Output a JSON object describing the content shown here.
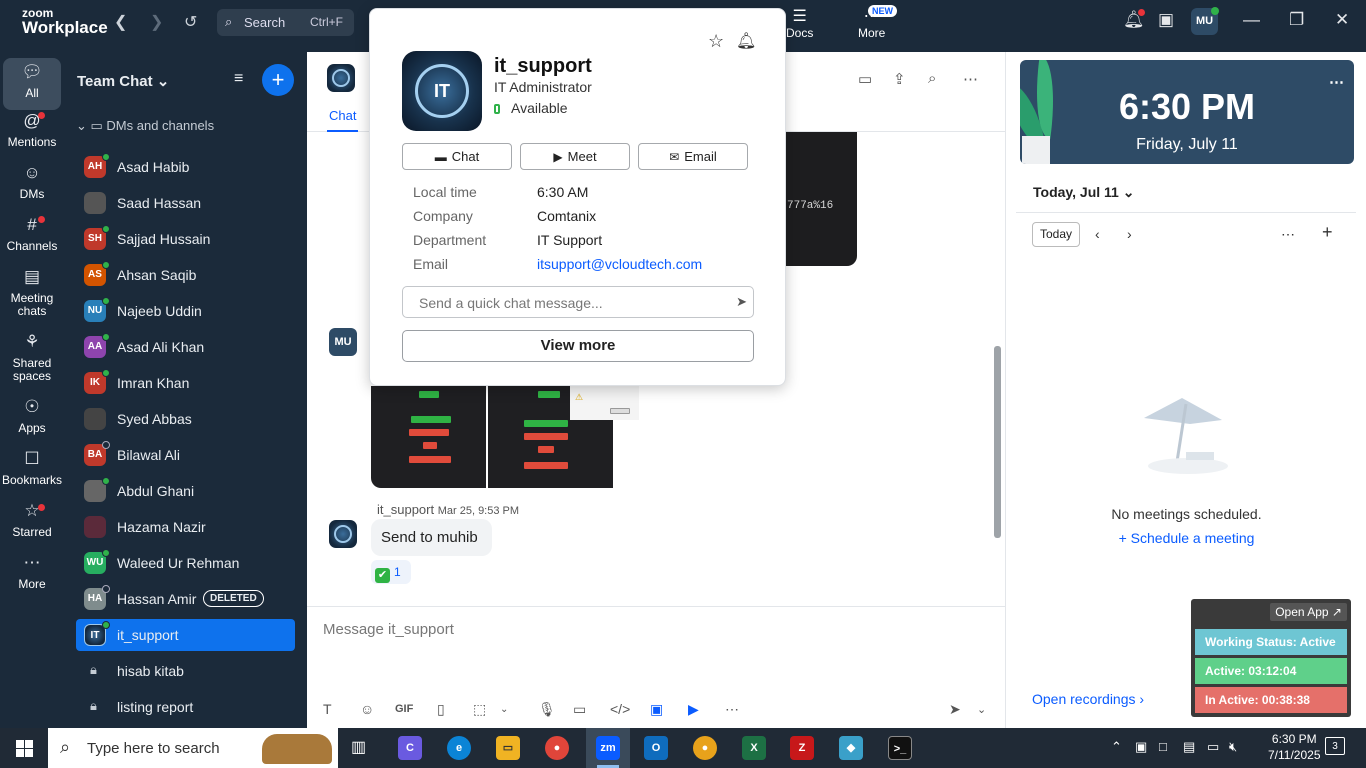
{
  "app": {
    "brand_top": "zoom",
    "brand_bottom": "Workplace",
    "search_placeholder": "Search",
    "search_shortcut": "Ctrl+F",
    "docs_label": "Docs",
    "more_label": "More",
    "new_badge": "NEW",
    "me_initials": "MU"
  },
  "rail": [
    {
      "label": "All",
      "icon": "chat-bubble-icon"
    },
    {
      "label": "Mentions",
      "icon": "at-icon"
    },
    {
      "label": "DMs",
      "icon": "people-icon"
    },
    {
      "label": "Channels",
      "icon": "hash-icon"
    },
    {
      "label": "Meeting chats",
      "icon": "calendar-icon"
    },
    {
      "label": "Shared spaces",
      "icon": "share-icon"
    },
    {
      "label": "Apps",
      "icon": "apps-icon"
    },
    {
      "label": "Bookmarks",
      "icon": "bookmark-icon"
    },
    {
      "label": "Starred",
      "icon": "star-icon"
    },
    {
      "label": "More",
      "icon": "more-icon"
    }
  ],
  "sidebar": {
    "title": "Team Chat",
    "section": "DMs and channels",
    "items": [
      {
        "initials": "AH",
        "name": "Asad Habib",
        "color": "#c0392b"
      },
      {
        "initials": "",
        "name": "Saad Hassan",
        "color": "#555"
      },
      {
        "initials": "SH",
        "name": "Sajjad Hussain",
        "color": "#c0392b"
      },
      {
        "initials": "AS",
        "name": "Ahsan Saqib",
        "color": "#d35400"
      },
      {
        "initials": "NU",
        "name": "Najeeb Uddin",
        "color": "#2980b9"
      },
      {
        "initials": "AA",
        "name": "Asad Ali Khan",
        "color": "#8e44ad"
      },
      {
        "initials": "IK",
        "name": "Imran Khan",
        "color": "#c0392b"
      },
      {
        "initials": "",
        "name": "Syed Abbas",
        "color": "#444"
      },
      {
        "initials": "BA",
        "name": "Bilawal Ali",
        "color": "#c0392b"
      },
      {
        "initials": "",
        "name": "Abdul Ghani",
        "color": "#666"
      },
      {
        "initials": "",
        "name": "Hazama Nazir",
        "color": "#5b2a3a"
      },
      {
        "initials": "WU",
        "name": "Waleed Ur Rehman",
        "color": "#27ae60"
      },
      {
        "initials": "HA",
        "name": "Hassan Amir",
        "color": "#7f8c8d",
        "badge": "DELETED"
      },
      {
        "initials": "IT",
        "name": "it_support",
        "color": "#18324c"
      },
      {
        "initials": "",
        "name": "hisab kitab",
        "color": ""
      },
      {
        "initials": "",
        "name": "listing report",
        "color": ""
      }
    ]
  },
  "chat": {
    "tab_label": "Chat",
    "code_snippet": "777a%16",
    "msg_sender": "it_support",
    "msg_date": "Mar 25, 9:53 PM",
    "msg_text": "Send to muhib",
    "reaction_count": "1",
    "composer_placeholder": "Message it_support",
    "other_avatar": "MU"
  },
  "popup": {
    "avatar_text": "IT",
    "name": "it_support",
    "title": "IT Administrator",
    "status": "Available",
    "buttons": {
      "chat": "Chat",
      "meet": "Meet",
      "email": "Email"
    },
    "details": [
      {
        "label": "Local time",
        "value": "6:30 AM"
      },
      {
        "label": "Company",
        "value": "Comtanix"
      },
      {
        "label": "Department",
        "value": "IT Support"
      },
      {
        "label": "Email",
        "value": "itsupport@vcloudtech.com"
      }
    ],
    "quick_placeholder": "Send a quick chat message...",
    "view_more": "View more"
  },
  "calendar": {
    "time": "6:30 PM",
    "date": "Friday, July 11",
    "today_heading": "Today, Jul 11",
    "today_btn": "Today",
    "no_meetings": "No meetings scheduled.",
    "schedule": "Schedule a meeting",
    "open_recordings": "Open recordings"
  },
  "status_widget": {
    "open_app": "Open App ↗",
    "working": "Working Status: Active",
    "active": "Active: 03:12:04",
    "inactive": "In Active: 00:38:38",
    "colors": {
      "working": "#6ec6d3",
      "active": "#5fd08a",
      "inactive": "#e5706a"
    }
  },
  "taskbar": {
    "search_placeholder": "Type here to search",
    "time": "6:30 PM",
    "date": "7/11/2025",
    "notif_count": "3"
  }
}
